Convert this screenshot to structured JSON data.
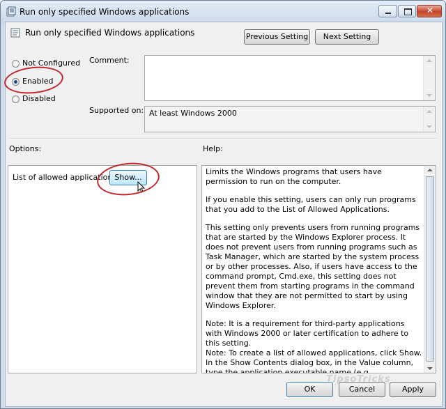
{
  "window": {
    "title": "Run only specified Windows applications"
  },
  "header": {
    "setting_name": "Run only specified Windows applications",
    "previous_label": "Previous Setting",
    "next_label": "Next Setting"
  },
  "state": {
    "options": [
      {
        "label": "Not Configured",
        "checked": false
      },
      {
        "label": "Enabled",
        "checked": true
      },
      {
        "label": "Disabled",
        "checked": false
      }
    ]
  },
  "comment": {
    "label": "Comment:",
    "value": ""
  },
  "supported": {
    "label": "Supported on:",
    "value": "At least Windows 2000"
  },
  "options_panel": {
    "heading": "Options:",
    "list_label": "List of allowed applications",
    "show_label": "Show..."
  },
  "help_panel": {
    "heading": "Help:",
    "paragraphs": [
      "Limits the Windows programs that users have permission to run on the computer.",
      "If you enable this setting, users can only run programs that you add to the List of Allowed Applications.",
      "This setting only prevents users from running programs that are started by the Windows Explorer process. It does not prevent users from running programs such as Task Manager, which are started by the system process or by other processes. Also, if users have access to the command prompt, Cmd.exe, this setting does not prevent them from starting programs in the command window that they are not permitted to start by using Windows Explorer.",
      "Note: It is a requirement for third-party applications with Windows 2000 or later certification to adhere to this setting.",
      "Note: To create a list of allowed applications, click Show. In the Show Contents dialog box, in the Value column, type the application executable name (e.g., Winword.exe, Poledit.exe, Powerpnt.exe)."
    ]
  },
  "footer": {
    "ok_label": "OK",
    "cancel_label": "Cancel",
    "apply_label": "Apply"
  },
  "watermark": "TipsoTricks",
  "colors": {
    "annotation": "#c0272d",
    "title_bar": "#c9d8ea",
    "dialog_bg": "#f0f0f0"
  }
}
